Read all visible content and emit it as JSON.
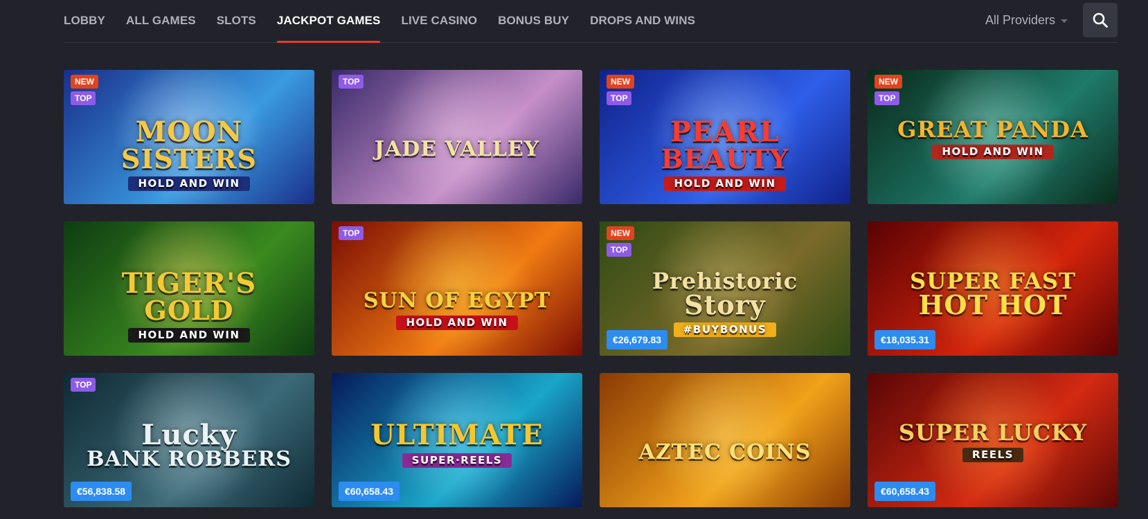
{
  "nav": {
    "tabs": [
      {
        "label": "LOBBY"
      },
      {
        "label": "ALL GAMES"
      },
      {
        "label": "SLOTS"
      },
      {
        "label": "JACKPOT GAMES",
        "active": true
      },
      {
        "label": "LIVE CASINO"
      },
      {
        "label": "BONUS BUY"
      },
      {
        "label": "DROPS AND WINS"
      }
    ],
    "providers_label": "All Providers",
    "search_icon": "search-icon"
  },
  "badge_labels": {
    "new": "NEW",
    "top": "TOP"
  },
  "games": [
    {
      "name": "moon-sisters",
      "line1": "MOON",
      "line2": "SISTERS",
      "sub": "HOLD AND WIN",
      "badges": [
        "NEW",
        "TOP"
      ],
      "jackpot": "",
      "colors": {
        "bg1": "#1a2f8a",
        "bg2": "#3a9ae0",
        "glow": "#cfe8ff",
        "title": "#f7c843",
        "sub": "#1d2f7a"
      }
    },
    {
      "name": "jade-valley",
      "line1": "",
      "line2": "JADE VALLEY",
      "sub": "",
      "badges": [
        "TOP"
      ],
      "jackpot": "",
      "colors": {
        "bg1": "#3a2a6a",
        "bg2": "#c58fc8",
        "glow": "#f0c6e6",
        "title": "#f3e3a2",
        "sub": "#1d6b4a"
      }
    },
    {
      "name": "pearl-beauty",
      "line1": "PEARL",
      "line2": "BEAUTY",
      "sub": "HOLD AND WIN",
      "badges": [
        "NEW",
        "TOP"
      ],
      "jackpot": "",
      "colors": {
        "bg1": "#10228a",
        "bg2": "#2f5ee8",
        "glow": "#a5c9ff",
        "title": "#ff3b2e",
        "sub": "#c41b1b"
      }
    },
    {
      "name": "great-panda",
      "line1": "GREAT PANDA",
      "line2": "",
      "sub": "HOLD AND WIN",
      "badges": [
        "NEW",
        "TOP"
      ],
      "jackpot": "",
      "colors": {
        "bg1": "#0a2a1a",
        "bg2": "#1f7a6a",
        "glow": "#9de0d0",
        "title": "#f5b42a",
        "sub": "#b3261e"
      }
    },
    {
      "name": "tigers-gold",
      "line1": "TIGER'S",
      "line2": "GOLD",
      "sub": "HOLD AND WIN",
      "badges": [],
      "jackpot": "",
      "colors": {
        "bg1": "#0e3d12",
        "bg2": "#3a8a1f",
        "glow": "#f6d96a",
        "title": "#f5c934",
        "sub": "#1a1a1a"
      }
    },
    {
      "name": "sun-of-egypt",
      "line1": "",
      "line2": "SUN OF EGYPT",
      "sub": "HOLD AND WIN",
      "badges": [
        "TOP"
      ],
      "jackpot": "",
      "colors": {
        "bg1": "#7a0d04",
        "bg2": "#f07a12",
        "glow": "#ffd84a",
        "title": "#f8d040",
        "sub": "#c8101a"
      }
    },
    {
      "name": "prehistoric-story",
      "line1": "Prehistoric",
      "line2": "Story",
      "sub": "#BUYBONUS",
      "badges": [
        "NEW",
        "TOP"
      ],
      "jackpot": "€26,679.83",
      "highlight": true,
      "colors": {
        "bg1": "#2e4a14",
        "bg2": "#7a6a2a",
        "glow": "#c7b36a",
        "title": "#f4e1a4",
        "sub": "#f2b01a"
      }
    },
    {
      "name": "super-fast-hot-hot",
      "line1": "SUPER FAST",
      "line2": "HOT HOT",
      "sub": "",
      "badges": [],
      "jackpot": "€18,035.31",
      "colors": {
        "bg1": "#5a0204",
        "bg2": "#d3240c",
        "glow": "#ff9a3a",
        "title": "#ffdf4a",
        "sub": "#b00"
      }
    },
    {
      "name": "lucky-bank-robbers",
      "line1": "Lucky",
      "line2": "BANK ROBBERS",
      "sub": "",
      "badges": [
        "TOP"
      ],
      "jackpot": "€56,838.58",
      "colors": {
        "bg1": "#0f2a34",
        "bg2": "#3c6a78",
        "glow": "#b9d2d8",
        "title": "#e9f3f6",
        "sub": "#23323a"
      }
    },
    {
      "name": "ultimate-super-reels",
      "line1": "ULTIMATE",
      "line2": "",
      "sub": "SUPER·REELS",
      "badges": [],
      "jackpot": "€60,658.43",
      "colors": {
        "bg1": "#061a5a",
        "bg2": "#1aa6c8",
        "glow": "#7fe6ff",
        "title": "#f6c72c",
        "sub": "#8a2b96"
      }
    },
    {
      "name": "aztec-coins",
      "line1": "",
      "line2": "AZTEC COINS",
      "sub": "",
      "badges": [],
      "jackpot": "",
      "colors": {
        "bg1": "#8a3a04",
        "bg2": "#f0a21a",
        "glow": "#ffd86a",
        "title": "#fde27a",
        "sub": "#5a2a04"
      }
    },
    {
      "name": "super-lucky-reels",
      "line1": "SUPER LUCKY",
      "line2": "",
      "sub": "REELS",
      "badges": [],
      "jackpot": "€60,658.43",
      "colors": {
        "bg1": "#5a0606",
        "bg2": "#d32a12",
        "glow": "#ff8a3a",
        "title": "#f8d060",
        "sub": "#4a2a10"
      }
    }
  ]
}
